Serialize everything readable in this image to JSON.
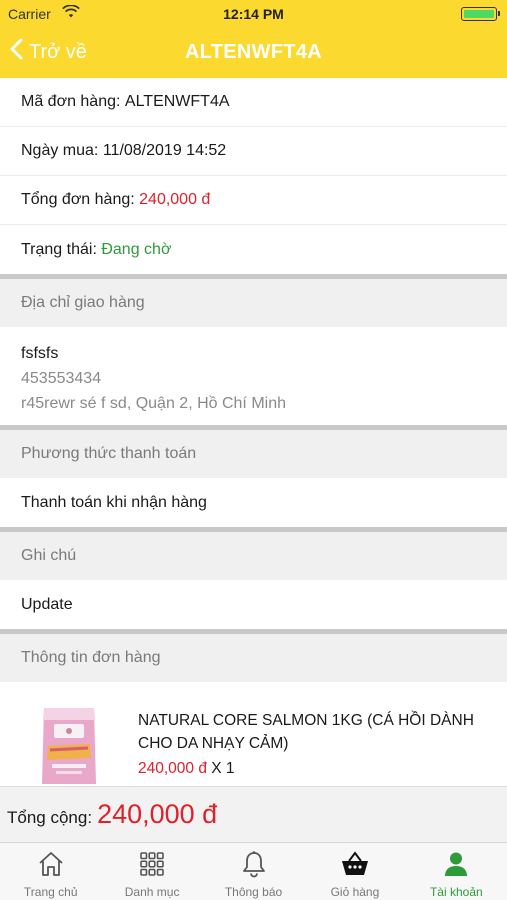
{
  "status_bar": {
    "carrier": "Carrier",
    "time": "12:14 PM"
  },
  "nav": {
    "back_label": "Trở về",
    "title": "ALTENWFT4A"
  },
  "order": {
    "code_label": "Mã đơn hàng:",
    "code_value": "ALTENWFT4A",
    "date_label": "Ngày mua:",
    "date_value": "11/08/2019 14:52",
    "total_label": "Tổng đơn hàng:",
    "total_value": "240,000 đ",
    "status_label": "Trạng thái:",
    "status_value": "Đang chờ"
  },
  "shipping": {
    "heading": "Địa chỉ giao hàng",
    "name": "fsfsfs",
    "phone": "453553434",
    "address": "r45rewr sé f sd, Quận 2, Hồ Chí Minh"
  },
  "payment": {
    "heading": "Phương thức thanh toán",
    "method": "Thanh toán khi nhận hàng"
  },
  "note": {
    "heading": "Ghi chú",
    "text": "Update"
  },
  "items_heading": "Thông tin đơn hàng",
  "items": [
    {
      "name": "NATURAL CORE SALMON 1KG (CÁ HỒI DÀNH CHO DA NHẠY CẢM)",
      "price": "240,000 đ",
      "qty": "X 1"
    }
  ],
  "summary": {
    "label": "Tổng cộng:",
    "amount": "240,000 đ"
  },
  "tabs": [
    {
      "label": "Trang chủ",
      "icon": "home-icon"
    },
    {
      "label": "Danh mục",
      "icon": "grid-icon"
    },
    {
      "label": "Thông báo",
      "icon": "bell-icon"
    },
    {
      "label": "Giỏ hàng",
      "icon": "basket-icon"
    },
    {
      "label": "Tài khoản",
      "icon": "user-icon",
      "active": true
    }
  ],
  "colors": {
    "brand_yellow": "#fbd92e",
    "price_red": "#e0202a",
    "status_green": "#2f9a3a"
  }
}
